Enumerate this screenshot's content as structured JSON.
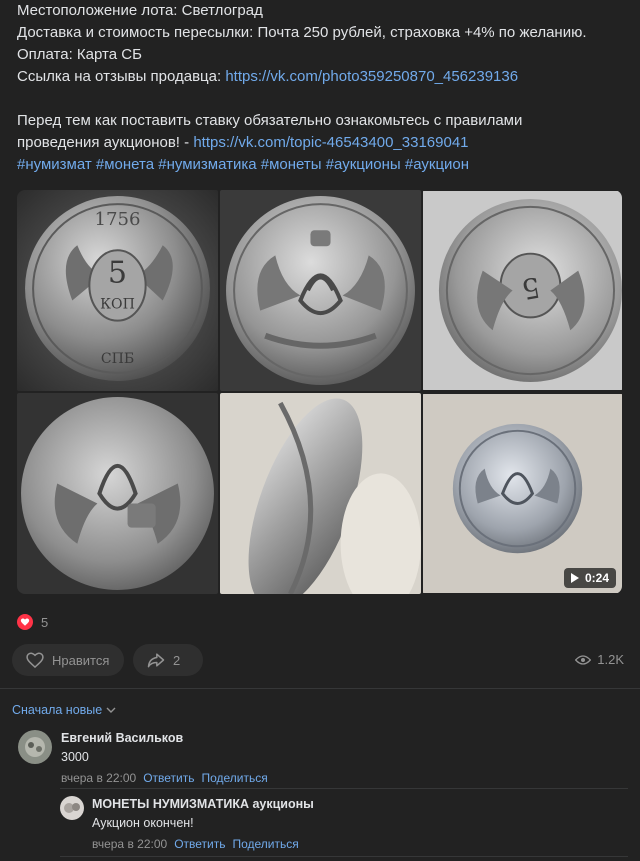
{
  "post": {
    "lines": [
      "Местоположение лота: Светлоград",
      "Доставка и стоимость пересылки: Почта 250 рублей, страховка +4% по желанию.",
      "Оплата: Карта СБ"
    ],
    "review_label": "Ссылка на отзывы продавца: ",
    "review_link": "https://vk.com/photo359250870_456239136",
    "rules_line1": "Перед тем как поставить ставку обязательно ознакомьтесь с правилами",
    "rules_line2_prefix": "проведения аукционов! - ",
    "rules_link": "https://vk.com/topic-46543400_33169041",
    "hashtags": [
      "#нумизмат",
      "#монета",
      "#нумизматика",
      "#монеты",
      "#аукционы",
      "#аукцион"
    ]
  },
  "gallery": {
    "video_duration": "0:24",
    "photo_labels": [
      "1756",
      "5 КОП",
      "СПБ"
    ]
  },
  "reactions": {
    "count": "5"
  },
  "actions": {
    "like_label": "Нравится",
    "share_count": "2",
    "views": "1.2K"
  },
  "comments": {
    "sort_label": "Сначала новые",
    "items": [
      {
        "author": "Евгений Васильков",
        "text": "3000",
        "time": "вчера в 22:00",
        "reply": "Ответить",
        "share": "Поделиться"
      },
      {
        "author": "МОНЕТЫ НУМИЗМАТИКА аукционы",
        "text": "Аукцион окончен!",
        "time": "вчера в 22:00",
        "reply": "Ответить",
        "share": "Поделиться"
      }
    ]
  },
  "colors": {
    "background": "#222222",
    "link": "#71aaeb",
    "text": "#e1e3e6",
    "muted": "#939393",
    "heart": "#ff3347"
  }
}
